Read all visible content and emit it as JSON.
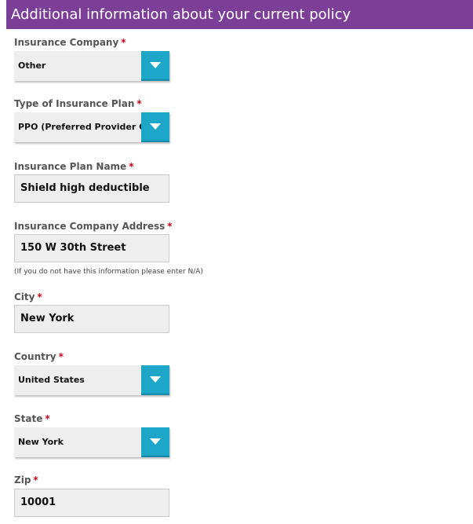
{
  "section_title": "Additional information about your current policy",
  "required_mark": "*",
  "fields": {
    "insurance_company": {
      "label": "Insurance Company",
      "value": "Other"
    },
    "plan_type": {
      "label": "Type of Insurance Plan",
      "value": "PPO (Preferred Provider Organization)"
    },
    "plan_name": {
      "label": "Insurance Plan Name",
      "value": "Shield high deductible"
    },
    "company_address": {
      "label": "Insurance Company Address",
      "value": "150 W 30th Street",
      "hint": "(If you do not have this information please enter N/A)"
    },
    "city": {
      "label": "City",
      "value": "New York"
    },
    "country": {
      "label": "Country",
      "value": "United States"
    },
    "state": {
      "label": "State",
      "value": "New York"
    },
    "zip": {
      "label": "Zip",
      "value": "10001"
    }
  }
}
